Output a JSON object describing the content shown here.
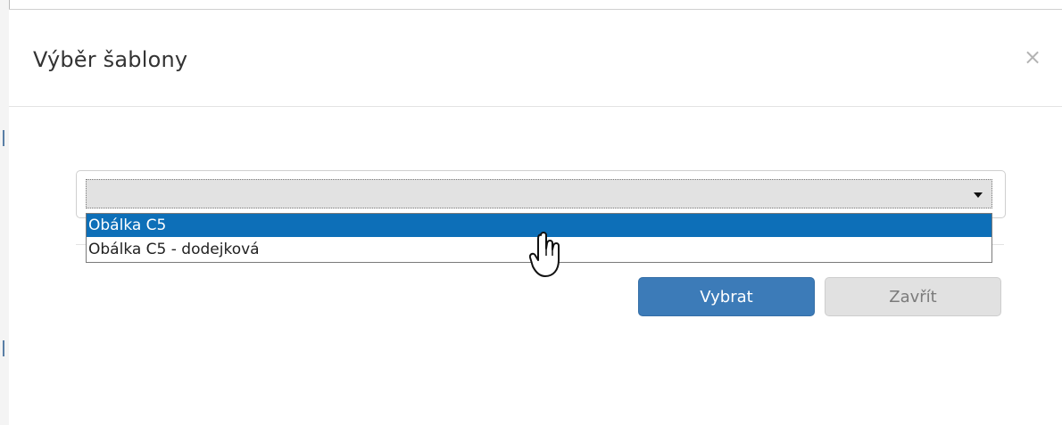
{
  "dialog": {
    "title": "Výběr šablony",
    "close_symbol": "×"
  },
  "template_select": {
    "selected_value": "",
    "options": [
      {
        "label": "Obálka C5",
        "highlighted": true
      },
      {
        "label": "Obálka C5 - dodejková",
        "highlighted": false
      }
    ]
  },
  "buttons": {
    "select_label": "Vybrat",
    "close_label": "Zavřít"
  },
  "icons": {
    "close": "close-icon",
    "dropdown": "caret-down-icon",
    "cursor": "hand-pointer-icon"
  },
  "colors": {
    "primary": "#3c7bb8",
    "highlight": "#0d6fb8",
    "secondary": "#e1e1e1"
  }
}
